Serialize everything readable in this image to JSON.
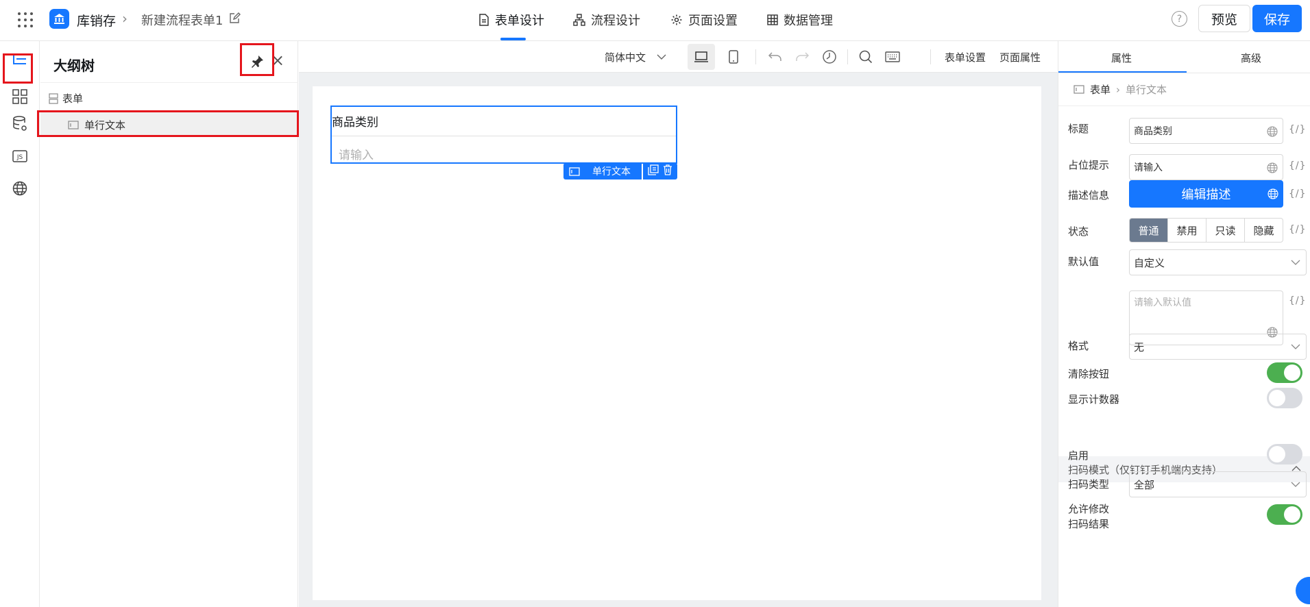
{
  "header": {
    "app_name": "库销存",
    "form_name": "新建流程表单1",
    "tabs": [
      {
        "label": "表单设计",
        "active": true
      },
      {
        "label": "流程设计",
        "active": false
      },
      {
        "label": "页面设置",
        "active": false
      },
      {
        "label": "数据管理",
        "active": false
      }
    ],
    "help_symbol": "?",
    "preview_label": "预览",
    "save_label": "保存"
  },
  "colors": {
    "accent": "#1677ff",
    "highlight_box": "#e5151c",
    "toggle_on": "#4caf50"
  },
  "rail": {
    "icons": [
      "outline-tree-icon",
      "components-grid-icon",
      "data-source-icon",
      "js-code-icon",
      "globe-icon"
    ],
    "js_label": "JS"
  },
  "outline": {
    "title": "大纲树",
    "root_label": "表单",
    "child_label": "单行文本"
  },
  "toolbar": {
    "language": "简体中文",
    "form_settings": "表单设置",
    "page_props": "页面属性"
  },
  "canvas": {
    "field_label": "商品类别",
    "field_placeholder": "请输入",
    "field_tag": "单行文本"
  },
  "props": {
    "tabs": [
      {
        "label": "属性",
        "active": true
      },
      {
        "label": "高级",
        "active": false
      }
    ],
    "breadcrumb_root": "表单",
    "breadcrumb_current": "单行文本",
    "fx_label": "{/}",
    "title_label": "标题",
    "title_value": "商品类别",
    "placeholder_label": "占位提示",
    "placeholder_value": "请输入",
    "desc_label": "描述信息",
    "desc_button": "编辑描述",
    "state_label": "状态",
    "state_options": [
      {
        "label": "普通",
        "selected": true
      },
      {
        "label": "禁用",
        "selected": false
      },
      {
        "label": "只读",
        "selected": false
      },
      {
        "label": "隐藏",
        "selected": false
      }
    ],
    "default_label": "默认值",
    "default_value": "自定义",
    "default_placeholder": "请输入默认值",
    "format_label": "格式",
    "format_value": "无",
    "clear_btn_label": "清除按钮",
    "clear_btn_on": true,
    "counter_label": "显示计数器",
    "counter_on": false,
    "scan_section": "扫码模式（仅钉钉手机端内支持）",
    "enable_label": "启用",
    "enable_on": false,
    "scan_type_label": "扫码类型",
    "scan_type_value": "全部",
    "allow_edit_label_1": "允许修改",
    "allow_edit_label_2": "扫码结果",
    "allow_edit_on": true
  }
}
